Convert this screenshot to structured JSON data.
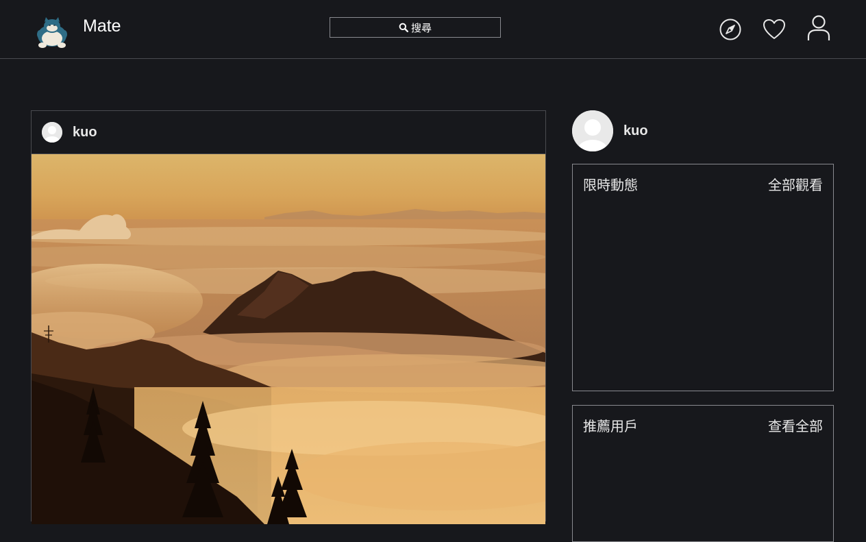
{
  "app": {
    "name": "Mate",
    "logo_icon": "sleeping-creature-logo"
  },
  "search": {
    "label": "搜尋",
    "icon": "search-icon"
  },
  "nav": {
    "items": [
      {
        "icon": "compass-icon",
        "name": "explore"
      },
      {
        "icon": "heart-icon",
        "name": "activity"
      },
      {
        "icon": "user-icon",
        "name": "profile"
      }
    ]
  },
  "post": {
    "username": "kuo",
    "image": "sunset-sea-of-clouds-mountains"
  },
  "sidebar": {
    "profile_name": "kuo",
    "stories": {
      "title": "限時動態",
      "link": "全部觀看"
    },
    "suggestions": {
      "title": "推薦用戶",
      "link": "查看全部"
    }
  },
  "colors": {
    "background": "#17181c",
    "border": "#4a4b50",
    "text": "#e8e8e8"
  }
}
